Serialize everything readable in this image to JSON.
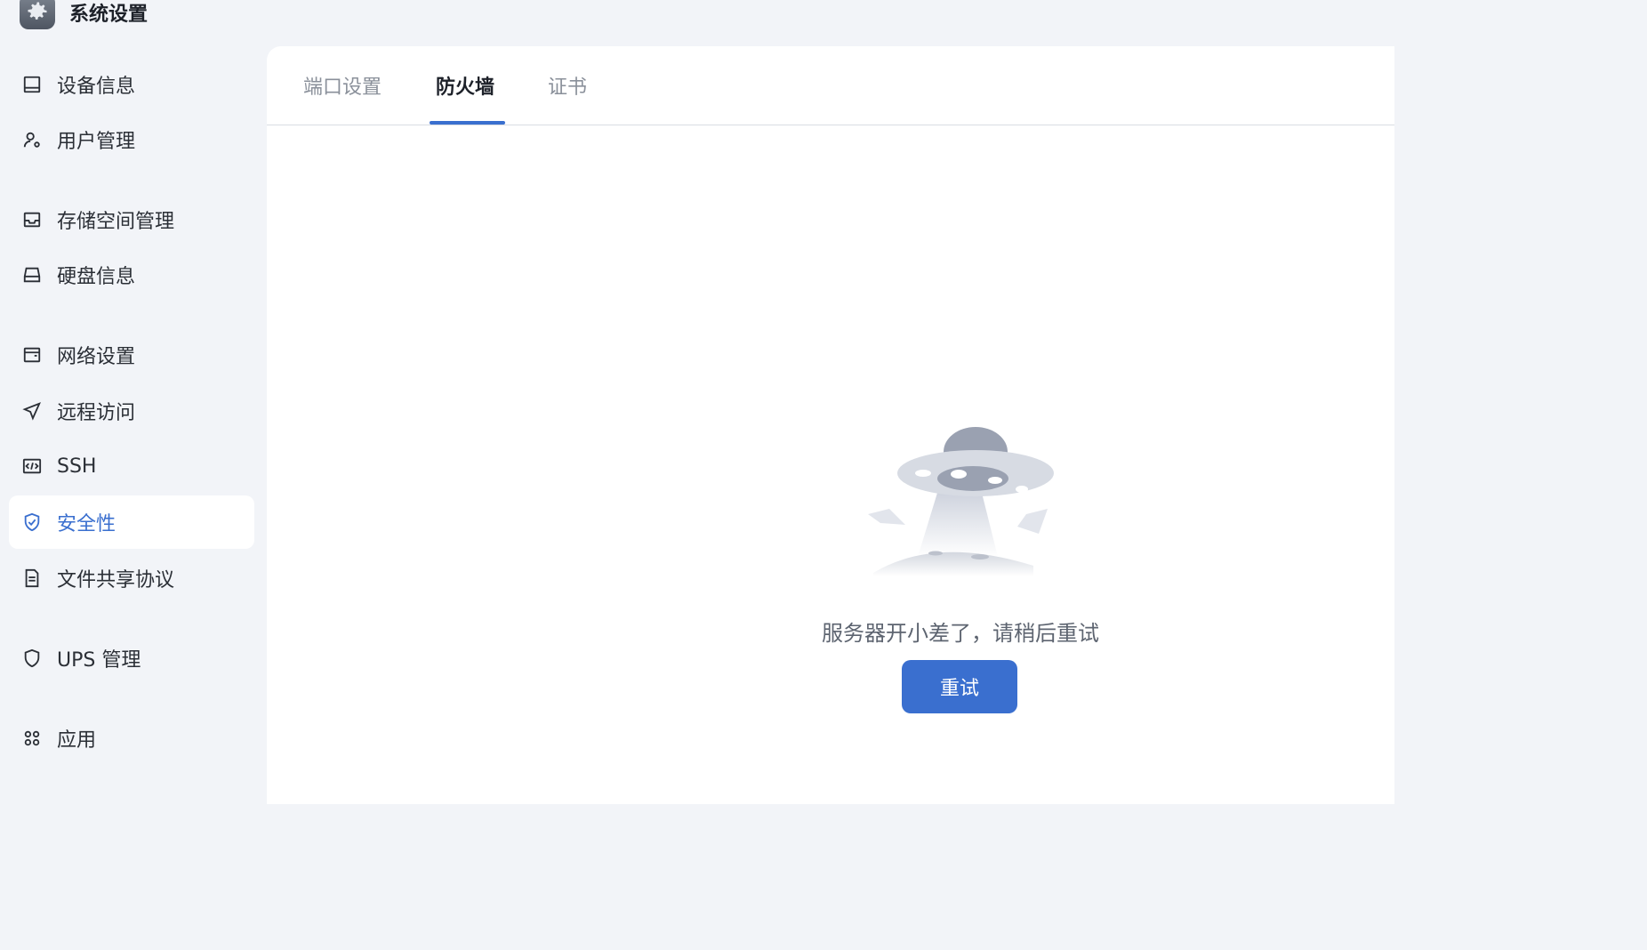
{
  "app": {
    "title": "系统设置",
    "icon": "gear-icon"
  },
  "sidebar": {
    "items": [
      {
        "label": "设备信息",
        "icon": "device-icon"
      },
      {
        "label": "用户管理",
        "icon": "user-settings-icon"
      },
      {
        "label": "存储空间管理",
        "icon": "storage-icon"
      },
      {
        "label": "硬盘信息",
        "icon": "disk-icon"
      },
      {
        "label": "网络设置",
        "icon": "network-icon"
      },
      {
        "label": "远程访问",
        "icon": "send-icon"
      },
      {
        "label": "SSH",
        "icon": "code-icon"
      },
      {
        "label": "安全性",
        "icon": "shield-check-icon",
        "active": true
      },
      {
        "label": "文件共享协议",
        "icon": "document-icon"
      },
      {
        "label": "UPS 管理",
        "icon": "shield-icon"
      },
      {
        "label": "应用",
        "icon": "apps-icon"
      }
    ]
  },
  "tabs": [
    {
      "label": "端口设置"
    },
    {
      "label": "防火墙",
      "active": true
    },
    {
      "label": "证书"
    }
  ],
  "error": {
    "message": "服务器开小差了，请稍后重试",
    "retry_label": "重试",
    "illustration": "ufo-illustration"
  },
  "colors": {
    "accent": "#3a6fcf",
    "background": "#f2f4f8",
    "panel": "#ffffff"
  }
}
